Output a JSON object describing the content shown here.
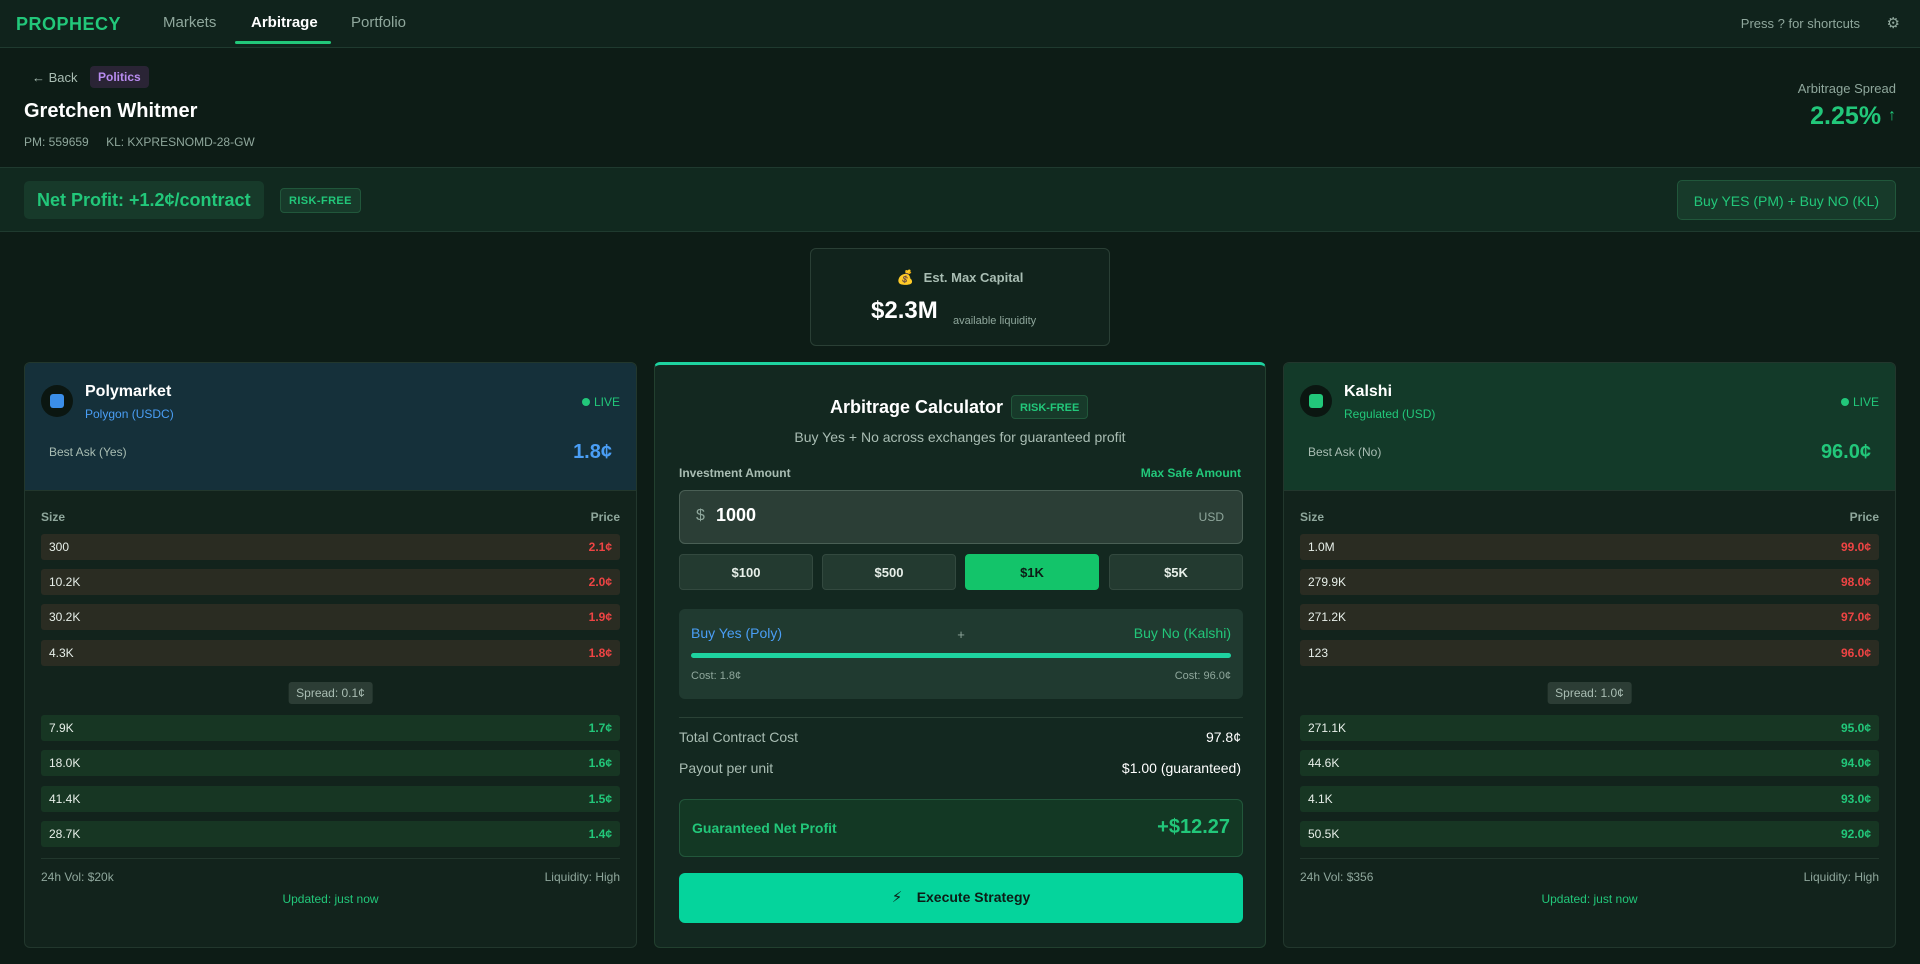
{
  "nav": {
    "logo": "PROPHECY",
    "tabs": [
      {
        "label": "Markets"
      },
      {
        "label": "Arbitrage"
      },
      {
        "label": "Portfolio"
      }
    ],
    "shortcuts_hint": "Press ? for shortcuts"
  },
  "header": {
    "back_label": "← Back",
    "category": "Politics",
    "title": "Gretchen Whitmer",
    "pm_id": "PM: 559659",
    "kl_id": "KL: KXPRESNOMD-28-GW",
    "spread_label": "Arbitrage Spread",
    "spread_value": "2.25%",
    "spread_arrow": "↑"
  },
  "banner": {
    "net_profit": "Net Profit: +1.2¢/contract",
    "risk_badge": "RISK-FREE",
    "strategy": "Buy YES (PM) + Buy NO (KL)"
  },
  "capital": {
    "icon": "moneybag-icon",
    "title": "Est. Max Capital",
    "value": "$2.3M",
    "sub": "available liquidity"
  },
  "polymarket": {
    "name": "Polymarket",
    "network": "Polygon (USDC)",
    "live": "LIVE",
    "best_ask_label": "Best Ask (Yes)",
    "best_ask_value": "1.8¢",
    "col_size": "Size",
    "col_price": "Price",
    "asks": [
      {
        "size": "300",
        "price": "2.1¢"
      },
      {
        "size": "10.2K",
        "price": "2.0¢"
      },
      {
        "size": "30.2K",
        "price": "1.9¢"
      },
      {
        "size": "4.3K",
        "price": "1.8¢"
      }
    ],
    "spread": "Spread: 0.1¢",
    "bids": [
      {
        "size": "7.9K",
        "price": "1.7¢"
      },
      {
        "size": "18.0K",
        "price": "1.6¢"
      },
      {
        "size": "41.4K",
        "price": "1.5¢"
      },
      {
        "size": "28.7K",
        "price": "1.4¢"
      }
    ],
    "volume": "24h Vol: $20k",
    "liquidity": "Liquidity: High",
    "updated": "Updated: just now"
  },
  "kalshi": {
    "name": "Kalshi",
    "network": "Regulated (USD)",
    "live": "LIVE",
    "best_ask_label": "Best Ask (No)",
    "best_ask_value": "96.0¢",
    "col_size": "Size",
    "col_price": "Price",
    "asks": [
      {
        "size": "1.0M",
        "price": "99.0¢"
      },
      {
        "size": "279.9K",
        "price": "98.0¢"
      },
      {
        "size": "271.2K",
        "price": "97.0¢"
      },
      {
        "size": "123",
        "price": "96.0¢"
      }
    ],
    "spread": "Spread: 1.0¢",
    "bids": [
      {
        "size": "271.1K",
        "price": "95.0¢"
      },
      {
        "size": "44.6K",
        "price": "94.0¢"
      },
      {
        "size": "4.1K",
        "price": "93.0¢"
      },
      {
        "size": "50.5K",
        "price": "92.0¢"
      }
    ],
    "volume": "24h Vol: $356",
    "liquidity": "Liquidity: High",
    "updated": "Updated: just now"
  },
  "calculator": {
    "title": "Arbitrage Calculator",
    "badge": "RISK-FREE",
    "subtitle": "Buy Yes + No across exchanges for guaranteed profit",
    "investment_label": "Investment Amount",
    "max_safe": "Max Safe Amount",
    "currency_symbol": "$",
    "amount": "1000",
    "unit": "USD",
    "presets": [
      "$100",
      "$500",
      "$1K",
      "$5K"
    ],
    "active_preset": "$1K",
    "leg_yes": "Buy Yes (Poly)",
    "leg_plus": "+",
    "leg_no": "Buy No (Kalshi)",
    "cost_yes": "Cost: 1.8¢",
    "cost_no": "Cost: 96.0¢",
    "total_cost_label": "Total Contract Cost",
    "total_cost_value": "97.8¢",
    "payout_label": "Payout per unit",
    "payout_value": "$1.00 (guaranteed)",
    "profit_label": "Guaranteed Net Profit",
    "profit_value": "+$12.27",
    "execute_label": "Execute Strategy"
  },
  "colors": {
    "accent": "#22c77a",
    "poly_blue": "#4a9ef5",
    "ask_red": "#ef4444",
    "execute": "#05d49c"
  }
}
